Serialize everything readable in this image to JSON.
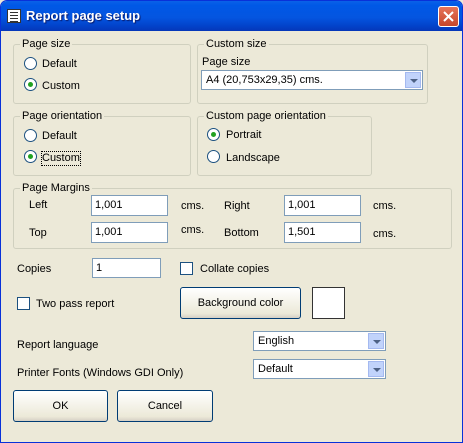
{
  "window": {
    "title": "Report page setup"
  },
  "page_size": {
    "label": "Page size",
    "options": [
      {
        "label": "Default",
        "checked": false
      },
      {
        "label": "Custom",
        "checked": true
      }
    ]
  },
  "custom_size": {
    "label": "Custom size",
    "field_label": "Page size",
    "selected": "A4 (20,753x29,35) cms."
  },
  "page_orientation": {
    "label": "Page orientation",
    "options": [
      {
        "label": "Default",
        "checked": false
      },
      {
        "label": "Custom",
        "checked": true
      }
    ]
  },
  "custom_orientation": {
    "label": "Custom page orientation",
    "options": [
      {
        "label": "Portrait",
        "checked": true
      },
      {
        "label": "Landscape",
        "checked": false
      }
    ]
  },
  "margins": {
    "label": "Page Margins",
    "left": {
      "label": "Left",
      "value": "1,001",
      "unit": "cms."
    },
    "right": {
      "label": "Right",
      "value": "1,001",
      "unit": "cms."
    },
    "top": {
      "label": "Top",
      "value": "1,001",
      "unit": "cms."
    },
    "bottom": {
      "label": "Bottom",
      "value": "1,501",
      "unit": "cms."
    }
  },
  "copies": {
    "label": "Copies",
    "value": "1"
  },
  "collate": {
    "label": "Collate copies",
    "checked": false
  },
  "two_pass": {
    "label": "Two pass report",
    "checked": false
  },
  "background_color": {
    "label": "Background color",
    "swatch": "#ffffff"
  },
  "report_language": {
    "label": "Report language",
    "selected": "English"
  },
  "printer_fonts": {
    "label": "Printer Fonts (Windows GDI Only)",
    "selected": "Default"
  },
  "buttons": {
    "ok": "OK",
    "cancel": "Cancel"
  },
  "colors": {
    "titlebar": "#0054e3",
    "face": "#ece9d8",
    "radio_dot": "#21a121"
  }
}
